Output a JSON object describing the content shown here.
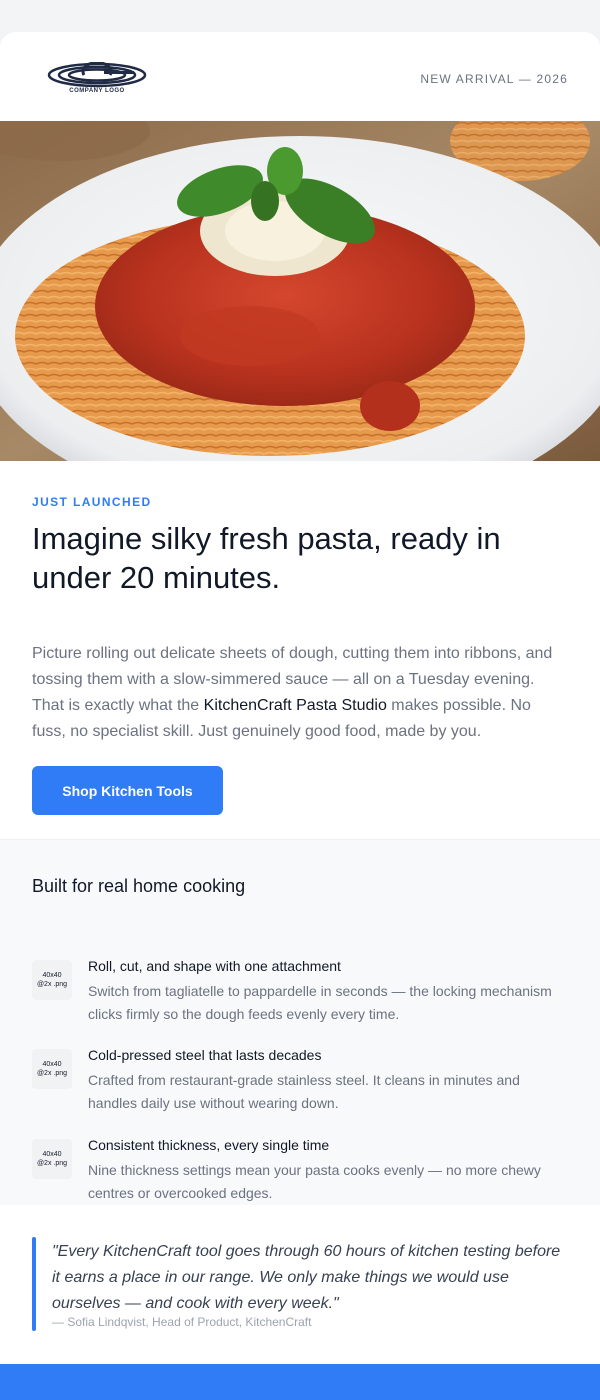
{
  "header": {
    "logo_text": "COMPANY LOGO",
    "meta": "NEW ARRIVAL — 2026"
  },
  "hero": {
    "image_semantic": "spaghetti-with-tomato-sauce-and-basil"
  },
  "main": {
    "eyebrow": "JUST LAUNCHED",
    "headline": "Imagine silky fresh pasta, ready in under 20 minutes.",
    "body_before": "Picture rolling out delicate sheets of dough, cutting them into ribbons, and tossing them with a slow-simmered sauce — all on a Tuesday evening. That is exactly what the ",
    "body_brand": "KitchenCraft Pasta Studio",
    "body_after": " makes possible. No fuss, no specialist skill. Just genuinely good food, made by you.",
    "cta_label": "Shop Kitchen Tools"
  },
  "features": {
    "title": "Built for real home cooking",
    "items": [
      {
        "icon_label": "40x40\n@2x .png",
        "title": "Roll, cut, and shape with one attachment",
        "desc": "Switch from tagliatelle to pappardelle in seconds — the locking mechanism clicks firmly so the dough feeds evenly every time."
      },
      {
        "icon_label": "40x40\n@2x .png",
        "title": "Cold-pressed steel that lasts decades",
        "desc": "Crafted from restaurant-grade stainless steel. It cleans in minutes and handles daily use without wearing down."
      },
      {
        "icon_label": "40x40\n@2x .png",
        "title": "Consistent thickness, every single time",
        "desc": "Nine thickness settings mean your pasta cooks evenly — no more chewy centres or overcooked edges."
      }
    ]
  },
  "quote": {
    "text": "\"Every KitchenCraft tool goes through 60 hours of kitchen testing before it earns a place in our range. We only make things we would use ourselves — and cook with every week.\"",
    "author": "— Sofia Lindqvist, Head of Product, KitchenCraft"
  },
  "colors": {
    "accent": "#2f7cf6",
    "background": "#f3f4f6",
    "text": "#111827",
    "muted": "#6b7280"
  }
}
